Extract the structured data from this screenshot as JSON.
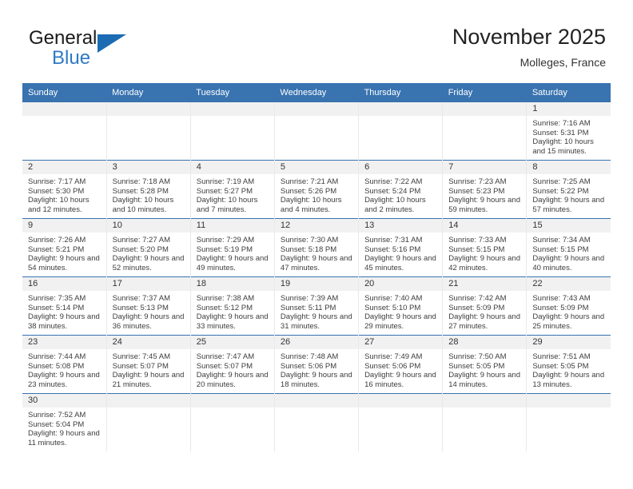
{
  "brand": {
    "name_top": "General",
    "name_bottom": "Blue",
    "triangle_icon": "brand-triangle-icon",
    "color_black": "#1a1a1a",
    "color_blue": "#2f7ac4"
  },
  "header": {
    "title": "November 2025",
    "subtitle": "Molleges, France"
  },
  "theme": {
    "header_blue": "#3973b0",
    "daynum_band": "#f1f1f1",
    "row_divider": "#3973b0",
    "col_divider": "#e9e9e9"
  },
  "weekday_headers": [
    "Sunday",
    "Monday",
    "Tuesday",
    "Wednesday",
    "Thursday",
    "Friday",
    "Saturday"
  ],
  "labels": {
    "sunrise_prefix": "Sunrise:",
    "sunset_prefix": "Sunset:",
    "daylight_prefix": "Daylight:"
  },
  "weeks": [
    [
      {
        "day": "",
        "empty": true
      },
      {
        "day": "",
        "empty": true
      },
      {
        "day": "",
        "empty": true
      },
      {
        "day": "",
        "empty": true
      },
      {
        "day": "",
        "empty": true
      },
      {
        "day": "",
        "empty": true
      },
      {
        "day": "1",
        "sunrise": "Sunrise: 7:16 AM",
        "sunset": "Sunset: 5:31 PM",
        "daylight": "Daylight: 10 hours and 15 minutes."
      }
    ],
    [
      {
        "day": "2",
        "sunrise": "Sunrise: 7:17 AM",
        "sunset": "Sunset: 5:30 PM",
        "daylight": "Daylight: 10 hours and 12 minutes."
      },
      {
        "day": "3",
        "sunrise": "Sunrise: 7:18 AM",
        "sunset": "Sunset: 5:28 PM",
        "daylight": "Daylight: 10 hours and 10 minutes."
      },
      {
        "day": "4",
        "sunrise": "Sunrise: 7:19 AM",
        "sunset": "Sunset: 5:27 PM",
        "daylight": "Daylight: 10 hours and 7 minutes."
      },
      {
        "day": "5",
        "sunrise": "Sunrise: 7:21 AM",
        "sunset": "Sunset: 5:26 PM",
        "daylight": "Daylight: 10 hours and 4 minutes."
      },
      {
        "day": "6",
        "sunrise": "Sunrise: 7:22 AM",
        "sunset": "Sunset: 5:24 PM",
        "daylight": "Daylight: 10 hours and 2 minutes."
      },
      {
        "day": "7",
        "sunrise": "Sunrise: 7:23 AM",
        "sunset": "Sunset: 5:23 PM",
        "daylight": "Daylight: 9 hours and 59 minutes."
      },
      {
        "day": "8",
        "sunrise": "Sunrise: 7:25 AM",
        "sunset": "Sunset: 5:22 PM",
        "daylight": "Daylight: 9 hours and 57 minutes."
      }
    ],
    [
      {
        "day": "9",
        "sunrise": "Sunrise: 7:26 AM",
        "sunset": "Sunset: 5:21 PM",
        "daylight": "Daylight: 9 hours and 54 minutes."
      },
      {
        "day": "10",
        "sunrise": "Sunrise: 7:27 AM",
        "sunset": "Sunset: 5:20 PM",
        "daylight": "Daylight: 9 hours and 52 minutes."
      },
      {
        "day": "11",
        "sunrise": "Sunrise: 7:29 AM",
        "sunset": "Sunset: 5:19 PM",
        "daylight": "Daylight: 9 hours and 49 minutes."
      },
      {
        "day": "12",
        "sunrise": "Sunrise: 7:30 AM",
        "sunset": "Sunset: 5:18 PM",
        "daylight": "Daylight: 9 hours and 47 minutes."
      },
      {
        "day": "13",
        "sunrise": "Sunrise: 7:31 AM",
        "sunset": "Sunset: 5:16 PM",
        "daylight": "Daylight: 9 hours and 45 minutes."
      },
      {
        "day": "14",
        "sunrise": "Sunrise: 7:33 AM",
        "sunset": "Sunset: 5:15 PM",
        "daylight": "Daylight: 9 hours and 42 minutes."
      },
      {
        "day": "15",
        "sunrise": "Sunrise: 7:34 AM",
        "sunset": "Sunset: 5:15 PM",
        "daylight": "Daylight: 9 hours and 40 minutes."
      }
    ],
    [
      {
        "day": "16",
        "sunrise": "Sunrise: 7:35 AM",
        "sunset": "Sunset: 5:14 PM",
        "daylight": "Daylight: 9 hours and 38 minutes."
      },
      {
        "day": "17",
        "sunrise": "Sunrise: 7:37 AM",
        "sunset": "Sunset: 5:13 PM",
        "daylight": "Daylight: 9 hours and 36 minutes."
      },
      {
        "day": "18",
        "sunrise": "Sunrise: 7:38 AM",
        "sunset": "Sunset: 5:12 PM",
        "daylight": "Daylight: 9 hours and 33 minutes."
      },
      {
        "day": "19",
        "sunrise": "Sunrise: 7:39 AM",
        "sunset": "Sunset: 5:11 PM",
        "daylight": "Daylight: 9 hours and 31 minutes."
      },
      {
        "day": "20",
        "sunrise": "Sunrise: 7:40 AM",
        "sunset": "Sunset: 5:10 PM",
        "daylight": "Daylight: 9 hours and 29 minutes."
      },
      {
        "day": "21",
        "sunrise": "Sunrise: 7:42 AM",
        "sunset": "Sunset: 5:09 PM",
        "daylight": "Daylight: 9 hours and 27 minutes."
      },
      {
        "day": "22",
        "sunrise": "Sunrise: 7:43 AM",
        "sunset": "Sunset: 5:09 PM",
        "daylight": "Daylight: 9 hours and 25 minutes."
      }
    ],
    [
      {
        "day": "23",
        "sunrise": "Sunrise: 7:44 AM",
        "sunset": "Sunset: 5:08 PM",
        "daylight": "Daylight: 9 hours and 23 minutes."
      },
      {
        "day": "24",
        "sunrise": "Sunrise: 7:45 AM",
        "sunset": "Sunset: 5:07 PM",
        "daylight": "Daylight: 9 hours and 21 minutes."
      },
      {
        "day": "25",
        "sunrise": "Sunrise: 7:47 AM",
        "sunset": "Sunset: 5:07 PM",
        "daylight": "Daylight: 9 hours and 20 minutes."
      },
      {
        "day": "26",
        "sunrise": "Sunrise: 7:48 AM",
        "sunset": "Sunset: 5:06 PM",
        "daylight": "Daylight: 9 hours and 18 minutes."
      },
      {
        "day": "27",
        "sunrise": "Sunrise: 7:49 AM",
        "sunset": "Sunset: 5:06 PM",
        "daylight": "Daylight: 9 hours and 16 minutes."
      },
      {
        "day": "28",
        "sunrise": "Sunrise: 7:50 AM",
        "sunset": "Sunset: 5:05 PM",
        "daylight": "Daylight: 9 hours and 14 minutes."
      },
      {
        "day": "29",
        "sunrise": "Sunrise: 7:51 AM",
        "sunset": "Sunset: 5:05 PM",
        "daylight": "Daylight: 9 hours and 13 minutes."
      }
    ],
    [
      {
        "day": "30",
        "sunrise": "Sunrise: 7:52 AM",
        "sunset": "Sunset: 5:04 PM",
        "daylight": "Daylight: 9 hours and 11 minutes."
      },
      {
        "day": "",
        "empty": true
      },
      {
        "day": "",
        "empty": true
      },
      {
        "day": "",
        "empty": true
      },
      {
        "day": "",
        "empty": true
      },
      {
        "day": "",
        "empty": true
      },
      {
        "day": "",
        "empty": true
      }
    ]
  ]
}
